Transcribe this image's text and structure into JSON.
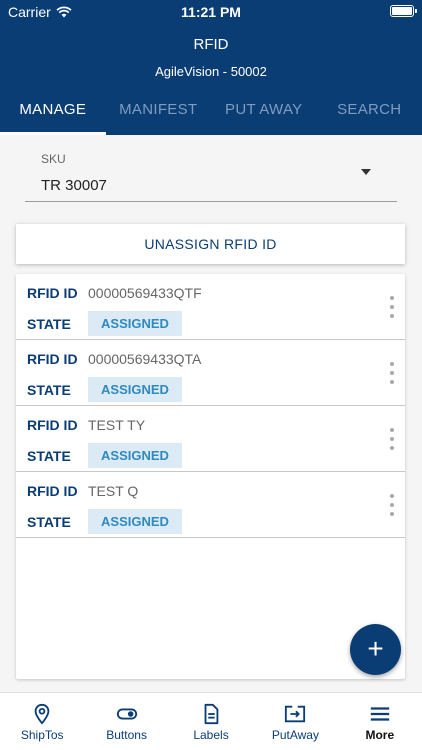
{
  "status_bar": {
    "carrier": "Carrier",
    "time": "11:21 PM"
  },
  "header": {
    "title": "RFID",
    "subtitle": "AgileVision - 50002"
  },
  "tabs": [
    {
      "label": "MANAGE",
      "active": true
    },
    {
      "label": "MANIFEST",
      "active": false
    },
    {
      "label": "PUT AWAY",
      "active": false
    },
    {
      "label": "SEARCH",
      "active": false
    }
  ],
  "sku": {
    "label": "SKU",
    "value": "TR 30007"
  },
  "unassign_label": "UNASSIGN RFID ID",
  "list": {
    "id_label": "RFID ID",
    "state_label": "STATE",
    "items": [
      {
        "rfid": "00000569433QTF",
        "state": "ASSIGNED"
      },
      {
        "rfid": "00000569433QTA",
        "state": "ASSIGNED"
      },
      {
        "rfid": "TEST TY",
        "state": "ASSIGNED"
      },
      {
        "rfid": "TEST Q",
        "state": "ASSIGNED"
      }
    ]
  },
  "fab_label": "+",
  "tabbar": [
    {
      "label": "ShipTos",
      "icon": "location-pin-icon"
    },
    {
      "label": "Buttons",
      "icon": "toggle-icon"
    },
    {
      "label": "Labels",
      "icon": "document-icon"
    },
    {
      "label": "PutAway",
      "icon": "put-away-icon"
    },
    {
      "label": "More",
      "icon": "hamburger-menu-icon",
      "active": true
    }
  ],
  "colors": {
    "primary": "#0b3d75",
    "badge_bg": "#dbeaf4",
    "badge_text": "#2f8ac0"
  }
}
